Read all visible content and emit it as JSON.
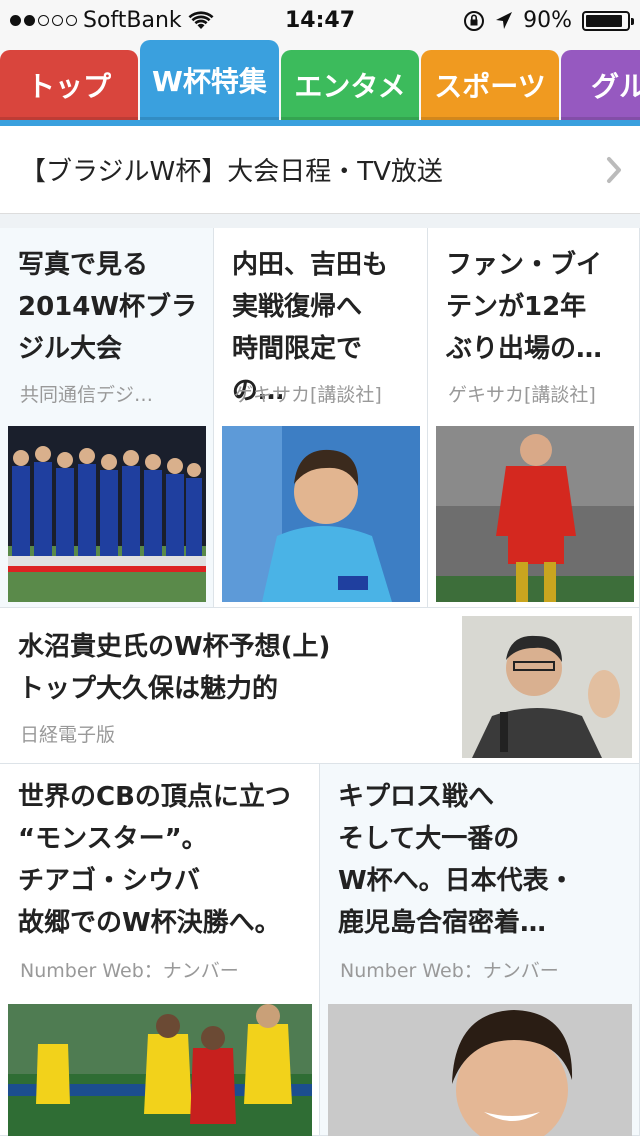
{
  "status_bar": {
    "carrier": "SoftBank",
    "signal_bars": 2,
    "signal_total": 5,
    "time": "14:47",
    "battery": "90%",
    "battery_level": 0.9
  },
  "tabs": [
    {
      "label": "トップ",
      "color": "#d9453d"
    },
    {
      "label": "W杯特集",
      "color": "#3aa0de",
      "selected": true
    },
    {
      "label": "エンタメ",
      "color": "#3cbb5c"
    },
    {
      "label": "スポーツ",
      "color": "#f09a20"
    },
    {
      "label": "グル",
      "color": "#9659c0"
    }
  ],
  "header": {
    "title": "【ブラジルW杯】大会日程・TV放送"
  },
  "articles": [
    {
      "title_lines": [
        "写真で見る",
        "2014W杯ブラ",
        "ジル大会"
      ],
      "source": "共同通信デジ…",
      "thumb": "japan-team-photo"
    },
    {
      "title_lines": [
        "内田、吉田も",
        "実戦復帰へ",
        "時間限定での…"
      ],
      "source": "ゲキサカ[講談社]",
      "thumb": "player-smiling-photo"
    },
    {
      "title_lines": [
        "ファン・ブイ",
        "テンが12年",
        "ぶり出場の…"
      ],
      "source": "ゲキサカ[講談社]",
      "thumb": "belgium-player-photo"
    },
    {
      "title_lines": [
        "水沼貴史氏のW杯予想(上)",
        "トップ大久保は魅力的"
      ],
      "source": "日経電子版",
      "thumb": "speaker-photo"
    },
    {
      "title_lines": [
        "世界のCBの頂点に立つ",
        "“モンスター”。",
        "チアゴ・シウバ",
        "故郷でのW杯決勝へ。"
      ],
      "source": "Number Web：ナンバー",
      "thumb": "brazil-match-photo"
    },
    {
      "title_lines": [
        "キプロス戦へ",
        "そして大一番の",
        "W杯へ。日本代表・",
        "鹿児島合宿密着…"
      ],
      "source": "Number Web：ナンバー",
      "thumb": "uchida-portrait-photo"
    }
  ],
  "icons": {
    "wifi": "wifi-icon",
    "orientation_lock": "orientation-lock-icon",
    "location": "location-arrow-icon",
    "chevron": "chevron-right-icon"
  }
}
